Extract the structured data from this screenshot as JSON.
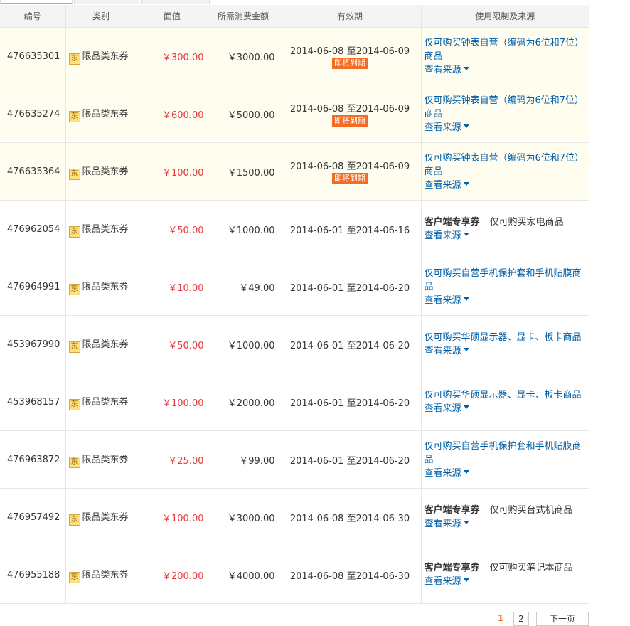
{
  "headers": {
    "id": "编号",
    "type": "类别",
    "face": "面值",
    "min": "所需消费金额",
    "valid": "有效期",
    "limit": "使用限制及来源"
  },
  "badge_icon": "东",
  "expiring_label": "即将到期",
  "source_label": "查看来源",
  "rows": [
    {
      "id": "476635301",
      "type": "限品类东券",
      "face": "￥300.00",
      "min": "￥3000.00",
      "start": "2014-06-08",
      "to": "至",
      "end": "2014-06-09",
      "expiring": true,
      "client": "",
      "limit": "仅可购买钟表自营（编码为6位和7位）商品"
    },
    {
      "id": "476635274",
      "type": "限品类东券",
      "face": "￥600.00",
      "min": "￥5000.00",
      "start": "2014-06-08",
      "to": "至",
      "end": "2014-06-09",
      "expiring": true,
      "client": "",
      "limit": "仅可购买钟表自营（编码为6位和7位）商品"
    },
    {
      "id": "476635364",
      "type": "限品类东券",
      "face": "￥100.00",
      "min": "￥1500.00",
      "start": "2014-06-08",
      "to": "至",
      "end": "2014-06-09",
      "expiring": true,
      "client": "",
      "limit": "仅可购买钟表自营（编码为6位和7位）商品"
    },
    {
      "id": "476962054",
      "type": "限品类东券",
      "face": "￥50.00",
      "min": "￥1000.00",
      "start": "2014-06-01",
      "to": "至",
      "end": "2014-06-16",
      "expiring": false,
      "client": "客户端专享券",
      "limit": "仅可购买家电商品"
    },
    {
      "id": "476964991",
      "type": "限品类东券",
      "face": "￥10.00",
      "min": "￥49.00",
      "start": "2014-06-01",
      "to": "至",
      "end": "2014-06-20",
      "expiring": false,
      "client": "",
      "limit": "仅可购买自营手机保护套和手机贴膜商品"
    },
    {
      "id": "453967990",
      "type": "限品类东券",
      "face": "￥50.00",
      "min": "￥1000.00",
      "start": "2014-06-01",
      "to": "至",
      "end": "2014-06-20",
      "expiring": false,
      "client": "",
      "limit": "仅可购买华硕显示器、显卡、板卡商品"
    },
    {
      "id": "453968157",
      "type": "限品类东券",
      "face": "￥100.00",
      "min": "￥2000.00",
      "start": "2014-06-01",
      "to": "至",
      "end": "2014-06-20",
      "expiring": false,
      "client": "",
      "limit": "仅可购买华硕显示器、显卡、板卡商品"
    },
    {
      "id": "476963872",
      "type": "限品类东券",
      "face": "￥25.00",
      "min": "￥99.00",
      "start": "2014-06-01",
      "to": "至",
      "end": "2014-06-20",
      "expiring": false,
      "client": "",
      "limit": "仅可购买自营手机保护套和手机贴膜商品"
    },
    {
      "id": "476957492",
      "type": "限品类东券",
      "face": "￥100.00",
      "min": "￥3000.00",
      "start": "2014-06-08",
      "to": "至",
      "end": "2014-06-30",
      "expiring": false,
      "client": "客户端专享券",
      "limit": "仅可购买台式机商品"
    },
    {
      "id": "476955188",
      "type": "限品类东券",
      "face": "￥200.00",
      "min": "￥4000.00",
      "start": "2014-06-08",
      "to": "至",
      "end": "2014-06-30",
      "expiring": false,
      "client": "客户端专享券",
      "limit": "仅可购买笔记本商品"
    }
  ],
  "pagination": {
    "current": "1",
    "page2": "2",
    "next": "下一页"
  },
  "colors": {
    "accent": "#f36c21",
    "price": "#e4393c",
    "link": "#005ea7",
    "expiring_row": "#fffdf0"
  }
}
